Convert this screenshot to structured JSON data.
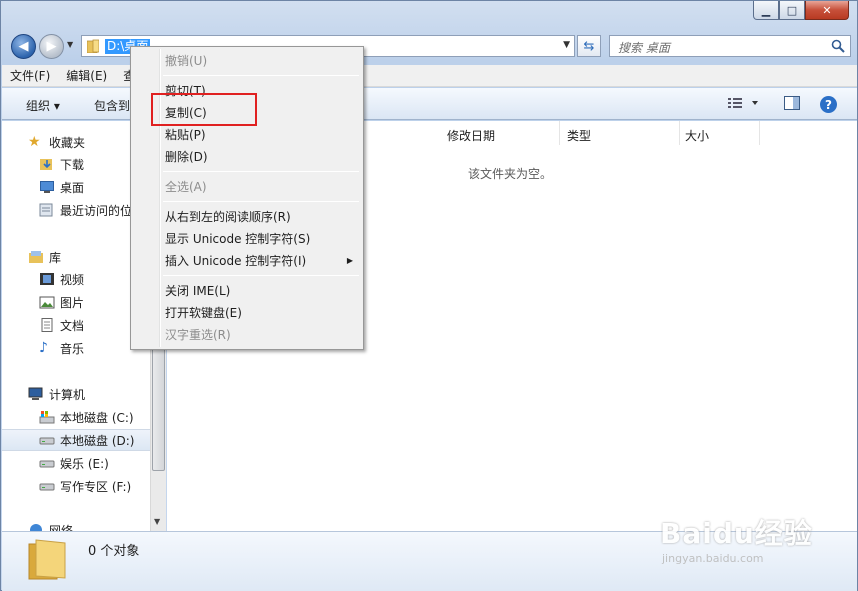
{
  "window": {
    "caption": {
      "min_glyph": "▁",
      "max_glyph": "□",
      "close_glyph": "✕"
    }
  },
  "nav": {
    "address": "D:\\桌面",
    "search_placeholder": "搜索 桌面"
  },
  "menubar": [
    "文件(F)",
    "编辑(E)",
    "查"
  ],
  "toolbar": {
    "organize": "组织 ▾",
    "include": "包含到"
  },
  "navpane": {
    "favorites": "收藏夹",
    "downloads": "下载",
    "desktop": "桌面",
    "recent": "最近访问的位",
    "library": "库",
    "videos": "视频",
    "pictures": "图片",
    "documents": "文档",
    "music": "音乐",
    "computer": "计算机",
    "drive_c": "本地磁盘 (C:)",
    "drive_d": "本地磁盘 (D:)",
    "drive_e": "娱乐 (E:)",
    "drive_f": "写作专区 (F:)",
    "network": "网络"
  },
  "content": {
    "columns": [
      "修改日期",
      "类型",
      "大小"
    ],
    "empty_message": "该文件夹为空。"
  },
  "details": {
    "count": "0 个对象"
  },
  "context_menu": {
    "undo": "撤销(U)",
    "cut": "剪切(T)",
    "copy": "复制(C)",
    "paste": "粘贴(P)",
    "delete": "删除(D)",
    "select_all": "全选(A)",
    "rtl": "从右到左的阅读顺序(R)",
    "show_unicode": "显示 Unicode 控制字符(S)",
    "insert_unicode": "插入 Unicode 控制字符(I)",
    "close_ime": "关闭 IME(L)",
    "open_keyboard": "打开软键盘(E)",
    "reconvert": "汉字重选(R)"
  },
  "watermark": {
    "main": "Baidu经验",
    "sub": "jingyan.baidu.com"
  },
  "colors": {
    "highlight_box": "#e02020",
    "selection": "#3399ff"
  }
}
